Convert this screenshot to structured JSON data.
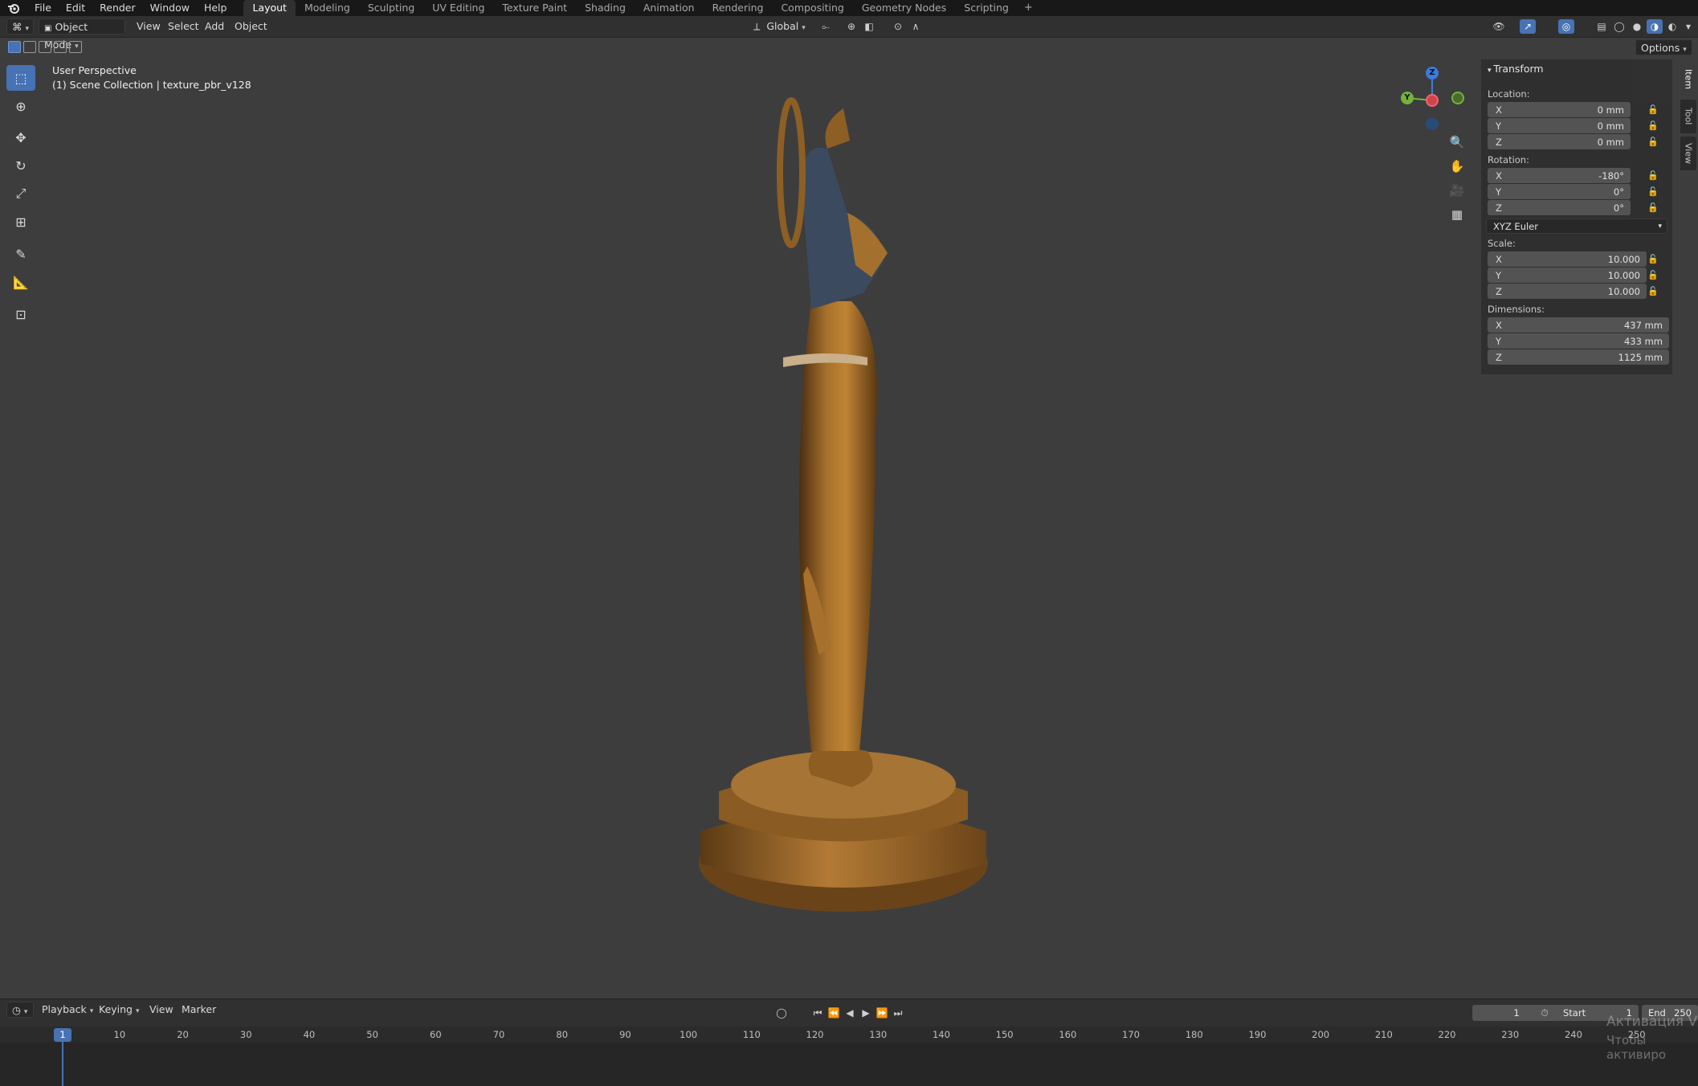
{
  "topbar": {
    "logo": "blender-logo",
    "menus": [
      "File",
      "Edit",
      "Render",
      "Window",
      "Help"
    ],
    "workspaces": [
      "Layout",
      "Modeling",
      "Sculpting",
      "UV Editing",
      "Texture Paint",
      "Shading",
      "Animation",
      "Rendering",
      "Compositing",
      "Geometry Nodes",
      "Scripting"
    ],
    "active_workspace": "Layout",
    "add_tab": "+"
  },
  "header": {
    "mode": "Object Mode",
    "menus": [
      "View",
      "Select",
      "Add",
      "Object"
    ],
    "orientation": "Global",
    "options": "Options"
  },
  "viewport": {
    "perspective": "User Perspective",
    "collection": "(1) Scene Collection | texture_pbr_v128",
    "model": "Egyptian lion-headed goddess bronze statue"
  },
  "gizmo": {
    "x": "X",
    "y": "Y",
    "z": "Z"
  },
  "npanel": {
    "section": "Transform",
    "location_label": "Location:",
    "location": [
      {
        "axis": "X",
        "value": "0 mm"
      },
      {
        "axis": "Y",
        "value": "0 mm"
      },
      {
        "axis": "Z",
        "value": "0 mm"
      }
    ],
    "rotation_label": "Rotation:",
    "rotation": [
      {
        "axis": "X",
        "value": "-180°"
      },
      {
        "axis": "Y",
        "value": "0°"
      },
      {
        "axis": "Z",
        "value": "0°"
      }
    ],
    "rotation_mode": "XYZ Euler",
    "scale_label": "Scale:",
    "scale": [
      {
        "axis": "X",
        "value": "10.000"
      },
      {
        "axis": "Y",
        "value": "10.000"
      },
      {
        "axis": "Z",
        "value": "10.000"
      }
    ],
    "dimensions_label": "Dimensions:",
    "dimensions": [
      {
        "axis": "X",
        "value": "437 mm"
      },
      {
        "axis": "Y",
        "value": "433 mm"
      },
      {
        "axis": "Z",
        "value": "1125 mm"
      }
    ],
    "tabs": [
      "Item",
      "Tool",
      "View"
    ]
  },
  "timeline": {
    "menus": [
      "Playback",
      "Keying",
      "View",
      "Marker"
    ],
    "current_frame": "1",
    "start_label": "Start",
    "start": "1",
    "end_label": "End",
    "end": "250",
    "ticks": [
      "1",
      "10",
      "20",
      "30",
      "40",
      "50",
      "60",
      "70",
      "80",
      "90",
      "100",
      "110",
      "120",
      "130",
      "140",
      "150",
      "160",
      "170",
      "180",
      "190",
      "200",
      "210",
      "220",
      "230",
      "240",
      "250"
    ],
    "marker": "1"
  },
  "watermark": {
    "line1": "Активация V",
    "line2": "Чтобы активиро"
  }
}
